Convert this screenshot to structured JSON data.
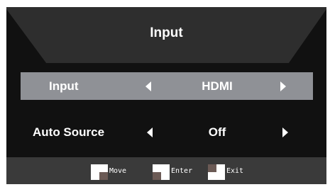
{
  "osd": {
    "title": "Input",
    "rows": [
      {
        "label": "Input",
        "value": "HDMI",
        "selected": true
      },
      {
        "label": "Auto Source",
        "value": "Off",
        "selected": false
      }
    ]
  },
  "footer": {
    "hints": [
      {
        "label": "Move",
        "icon": "move-icon"
      },
      {
        "label": "Enter",
        "icon": "enter-icon"
      },
      {
        "label": "Exit",
        "icon": "exit-icon"
      }
    ]
  },
  "colors": {
    "background": "#111111",
    "header_shape": "#2e2e2e",
    "selected_row": "#8f9196",
    "footer": "#3a3a3a",
    "text": "#ffffff"
  }
}
